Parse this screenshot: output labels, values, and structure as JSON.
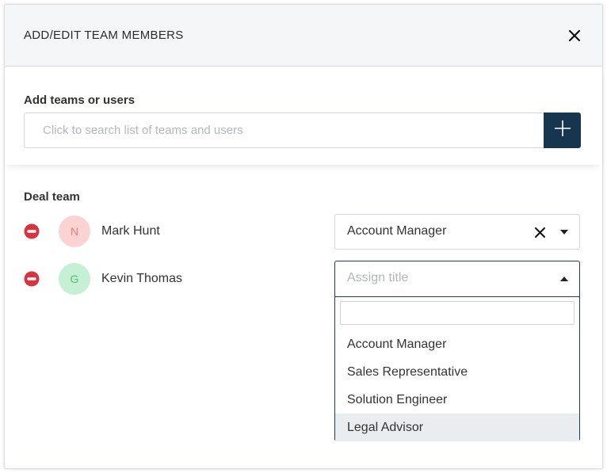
{
  "modal": {
    "title": "ADD/EDIT TEAM MEMBERS",
    "close_icon": "close-icon"
  },
  "add_section": {
    "label": "Add teams or users",
    "search_placeholder": "Click to search list of teams and users",
    "add_icon": "plus-icon"
  },
  "deal_team": {
    "label": "Deal team",
    "members": [
      {
        "initial": "N",
        "name": "Mark Hunt",
        "avatar_bg": "#fbd3d3",
        "avatar_fg": "#e2807f",
        "title": "Account Manager"
      },
      {
        "initial": "G",
        "name": "Kevin Thomas",
        "avatar_bg": "#c6f0d6",
        "avatar_fg": "#4fbf7b",
        "title_placeholder": "Assign title"
      }
    ]
  },
  "title_dropdown": {
    "filter_value": "",
    "options": [
      "Account Manager",
      "Sales Representative",
      "Solution Engineer",
      "Legal Advisor"
    ],
    "highlighted": "Legal Advisor"
  },
  "colors": {
    "accent": "#16364f",
    "remove": "#d9333f"
  }
}
